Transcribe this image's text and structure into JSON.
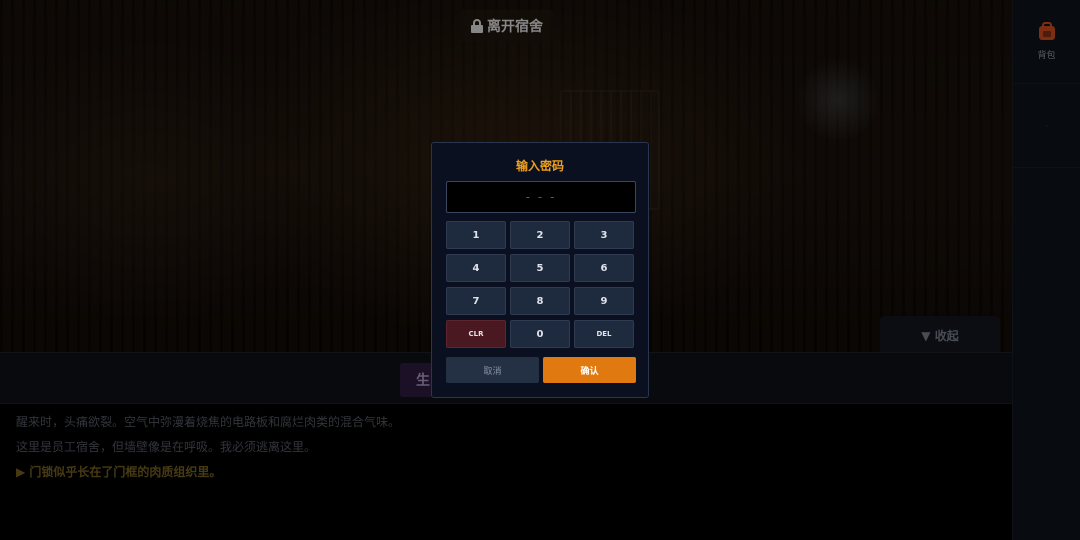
{
  "header": {
    "leave_label": "离开宿舍",
    "leave_icon": "lock-icon"
  },
  "sidebar": {
    "items": [
      {
        "label": "背包",
        "icon": "backpack-icon"
      },
      {
        "label": "·",
        "icon": ""
      }
    ]
  },
  "panel": {
    "collapse_label": "▼ 收起"
  },
  "status": {
    "chip_label": "生"
  },
  "narrative": {
    "lines": [
      "醒来时，头痛欲裂。空气中弥漫着烧焦的电路板和腐烂肉类的混合气味。",
      "这里是员工宿舍，但墙壁像是在呼吸。我必须逃离这里。",
      "▶ 门锁似乎长在了门框的肉质组织里。"
    ]
  },
  "modal": {
    "title": "输入密码",
    "display": "- - -",
    "keys": [
      "1",
      "2",
      "3",
      "4",
      "5",
      "6",
      "7",
      "8",
      "9",
      "CLR",
      "0",
      "DEL"
    ],
    "cancel_label": "取消",
    "confirm_label": "确认"
  },
  "colors": {
    "accent": "#f0a020",
    "confirm": "#e07a10",
    "clear_key": "#4a1820",
    "key_bg": "#1e2a3e",
    "modal_bg": "#0a1020"
  }
}
